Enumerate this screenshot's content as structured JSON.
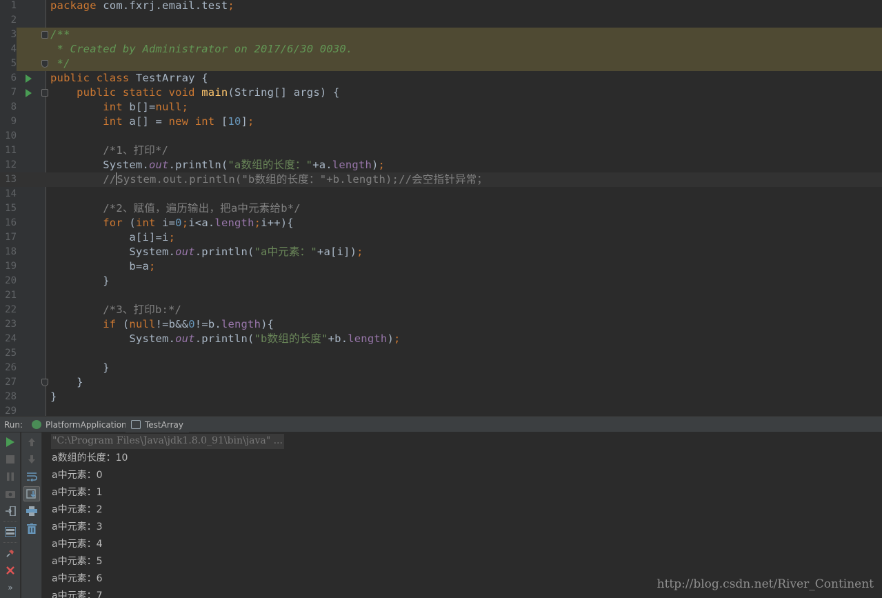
{
  "editor": {
    "lines": [
      {
        "n": "1",
        "html": "<span class=\"kw\">package</span> com.fxrj.email.test<span class=\"kw\">;</span>"
      },
      {
        "n": "2",
        "html": ""
      },
      {
        "n": "3",
        "html": "<span class=\"doc\">/**</span>"
      },
      {
        "n": "4",
        "html": "<span class=\"doc\"> * Created by Administrator on 2017/6/30 0030.</span>"
      },
      {
        "n": "5",
        "html": "<span class=\"doc\"> */</span>"
      },
      {
        "n": "6",
        "html": "<span class=\"kw\">public class</span> TestArray {"
      },
      {
        "n": "7",
        "html": "    <span class=\"kw\">public static void</span> <span class=\"fn\">main</span>(String[] args) {"
      },
      {
        "n": "8",
        "html": "        <span class=\"kw\">int</span> b[]=<span class=\"kw\">null;</span>"
      },
      {
        "n": "9",
        "html": "        <span class=\"kw\">int</span> a[] = <span class=\"kw\">new int</span> [<span class=\"num\">10</span>]<span class=\"kw\">;</span>"
      },
      {
        "n": "10",
        "html": ""
      },
      {
        "n": "11",
        "html": "        <span class=\"cm\">/*1、打印*/</span>"
      },
      {
        "n": "12",
        "html": "        System.<span class=\"sfld\">out</span>.println(<span class=\"str\">\"a数组的长度：\"</span>+a.<span class=\"fld\">length</span>)<span class=\"kw\">;</span>"
      },
      {
        "n": "13",
        "html": "        <span class=\"cm\">//<span class=\"cur-caret\"></span>System.out.println(\"b数组的长度：\"+b.length);//会空指针异常；</span>"
      },
      {
        "n": "14",
        "html": ""
      },
      {
        "n": "15",
        "html": "        <span class=\"cm\">/*2、赋值，遍历输出，把a中元素给b*/</span>"
      },
      {
        "n": "16",
        "html": "        <span class=\"kw\">for</span> (<span class=\"kw\">int</span> i=<span class=\"num\">0</span><span class=\"kw\">;</span>i&lt;a.<span class=\"fld\">length</span><span class=\"kw\">;</span>i++){"
      },
      {
        "n": "17",
        "html": "            a[i]=i<span class=\"kw\">;</span>"
      },
      {
        "n": "18",
        "html": "            System.<span class=\"sfld\">out</span>.println(<span class=\"str\">\"a中元素：\"</span>+a[i])<span class=\"kw\">;</span>"
      },
      {
        "n": "19",
        "html": "            b=a<span class=\"kw\">;</span>"
      },
      {
        "n": "20",
        "html": "        }"
      },
      {
        "n": "21",
        "html": ""
      },
      {
        "n": "22",
        "html": "        <span class=\"cm\">/*3、打印b:*/</span>"
      },
      {
        "n": "23",
        "html": "        <span class=\"kw\">if</span> (<span class=\"kw\">null</span>!=b&amp;&amp;<span class=\"num\">0</span>!=b.<span class=\"fld\">length</span>){"
      },
      {
        "n": "24",
        "html": "            System.<span class=\"sfld\">out</span>.println(<span class=\"str\">\"b数组的长度\"</span>+b.<span class=\"fld\">length</span>)<span class=\"kw\">;</span>"
      },
      {
        "n": "25",
        "html": ""
      },
      {
        "n": "26",
        "html": "        }"
      },
      {
        "n": "27",
        "html": "    }"
      },
      {
        "n": "28",
        "html": "}"
      },
      {
        "n": "29",
        "html": ""
      }
    ]
  },
  "run": {
    "label": "Run:",
    "tabs": [
      "PlatformApplication",
      "TestArray"
    ],
    "command": "\"C:\\Program Files\\Java\\jdk1.8.0_91\\bin\\java\" ...",
    "output": [
      "a数组的长度：10",
      "a中元素：0",
      "a中元素：1",
      "a中元素：2",
      "a中元素：3",
      "a中元素：4",
      "a中元素：5",
      "a中元素：6",
      "a中元素：7"
    ]
  },
  "watermark": "http://blog.csdn.net/River_Continent",
  "colors": {
    "editor_bg": "#2b2b2b",
    "keyword": "#cc7832",
    "string": "#6a8759",
    "number": "#6897bb",
    "field": "#9876aa",
    "doc_comment": "#629755",
    "comment": "#808080",
    "run_green": "#499c54"
  }
}
